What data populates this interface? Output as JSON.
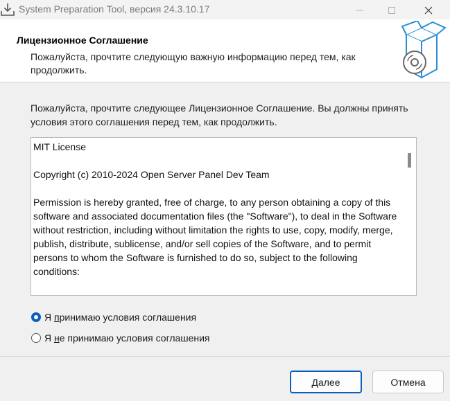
{
  "window": {
    "title": "System Preparation Tool, версия 24.3.10.17",
    "app_icon": "download-tray-icon",
    "controls": [
      "minimize-icon",
      "maximize-icon",
      "close-icon"
    ]
  },
  "header": {
    "title": "Лицензионное Соглашение",
    "subtitle": "Пожалуйста, прочтите следующую важную информацию перед тем, как продолжить.",
    "image": "software-box-disc-icon"
  },
  "intro": "Пожалуйста, прочтите следующее Лицензионное Соглашение. Вы должны принять условия этого соглашения перед тем, как продолжить.",
  "license": {
    "paragraphs": [
      "MIT License",
      "Copyright (c) 2010-2024 Open Server Panel Dev Team",
      "Permission is hereby granted, free of charge, to any person obtaining a copy of this software and associated documentation files (the \"Software\"), to deal in the Software without restriction, including without limitation the rights to use, copy, modify, merge, publish, distribute, sublicense, and/or sell copies of the Software, and to permit persons to whom the Software is furnished to do so, subject to the following conditions:"
    ]
  },
  "options": {
    "accept": {
      "pre": "Я ",
      "accel": "п",
      "post": "ринимаю условия соглашения",
      "selected": true
    },
    "decline": {
      "pre": "Я ",
      "accel": "н",
      "post": "е принимаю условия соглашения",
      "selected": false
    }
  },
  "buttons": {
    "next": "Далее",
    "cancel": "Отмена"
  },
  "colors": {
    "accent": "#0a5fc0",
    "box_icon": "#2a8fd8"
  }
}
